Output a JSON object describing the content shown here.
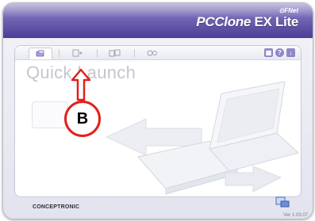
{
  "app": {
    "brand_prefix": "⊙FNet",
    "brand_name_a": "PCClone ",
    "brand_name_b": "EX Lite",
    "version": "Ver 1.03.07",
    "footer_logo": "CONCEPTRONIC"
  },
  "toolbar": {
    "tabs": [
      {
        "icon": "quick-launch-icon"
      },
      {
        "icon": "document-transfer-icon"
      },
      {
        "icon": "folder-sync-icon"
      },
      {
        "icon": "settings-tools-icon"
      }
    ],
    "right_buttons": [
      {
        "icon": "grid-icon",
        "glyph": "▦"
      },
      {
        "icon": "help-icon",
        "glyph": "?"
      },
      {
        "icon": "download-icon",
        "glyph": "↓"
      }
    ]
  },
  "main": {
    "heading": "Quick Launch"
  },
  "annotation": {
    "label": "B",
    "color": "#e0201c"
  },
  "colors": {
    "titlebar": "#5a4ea6",
    "accent": "#6b62b5"
  }
}
